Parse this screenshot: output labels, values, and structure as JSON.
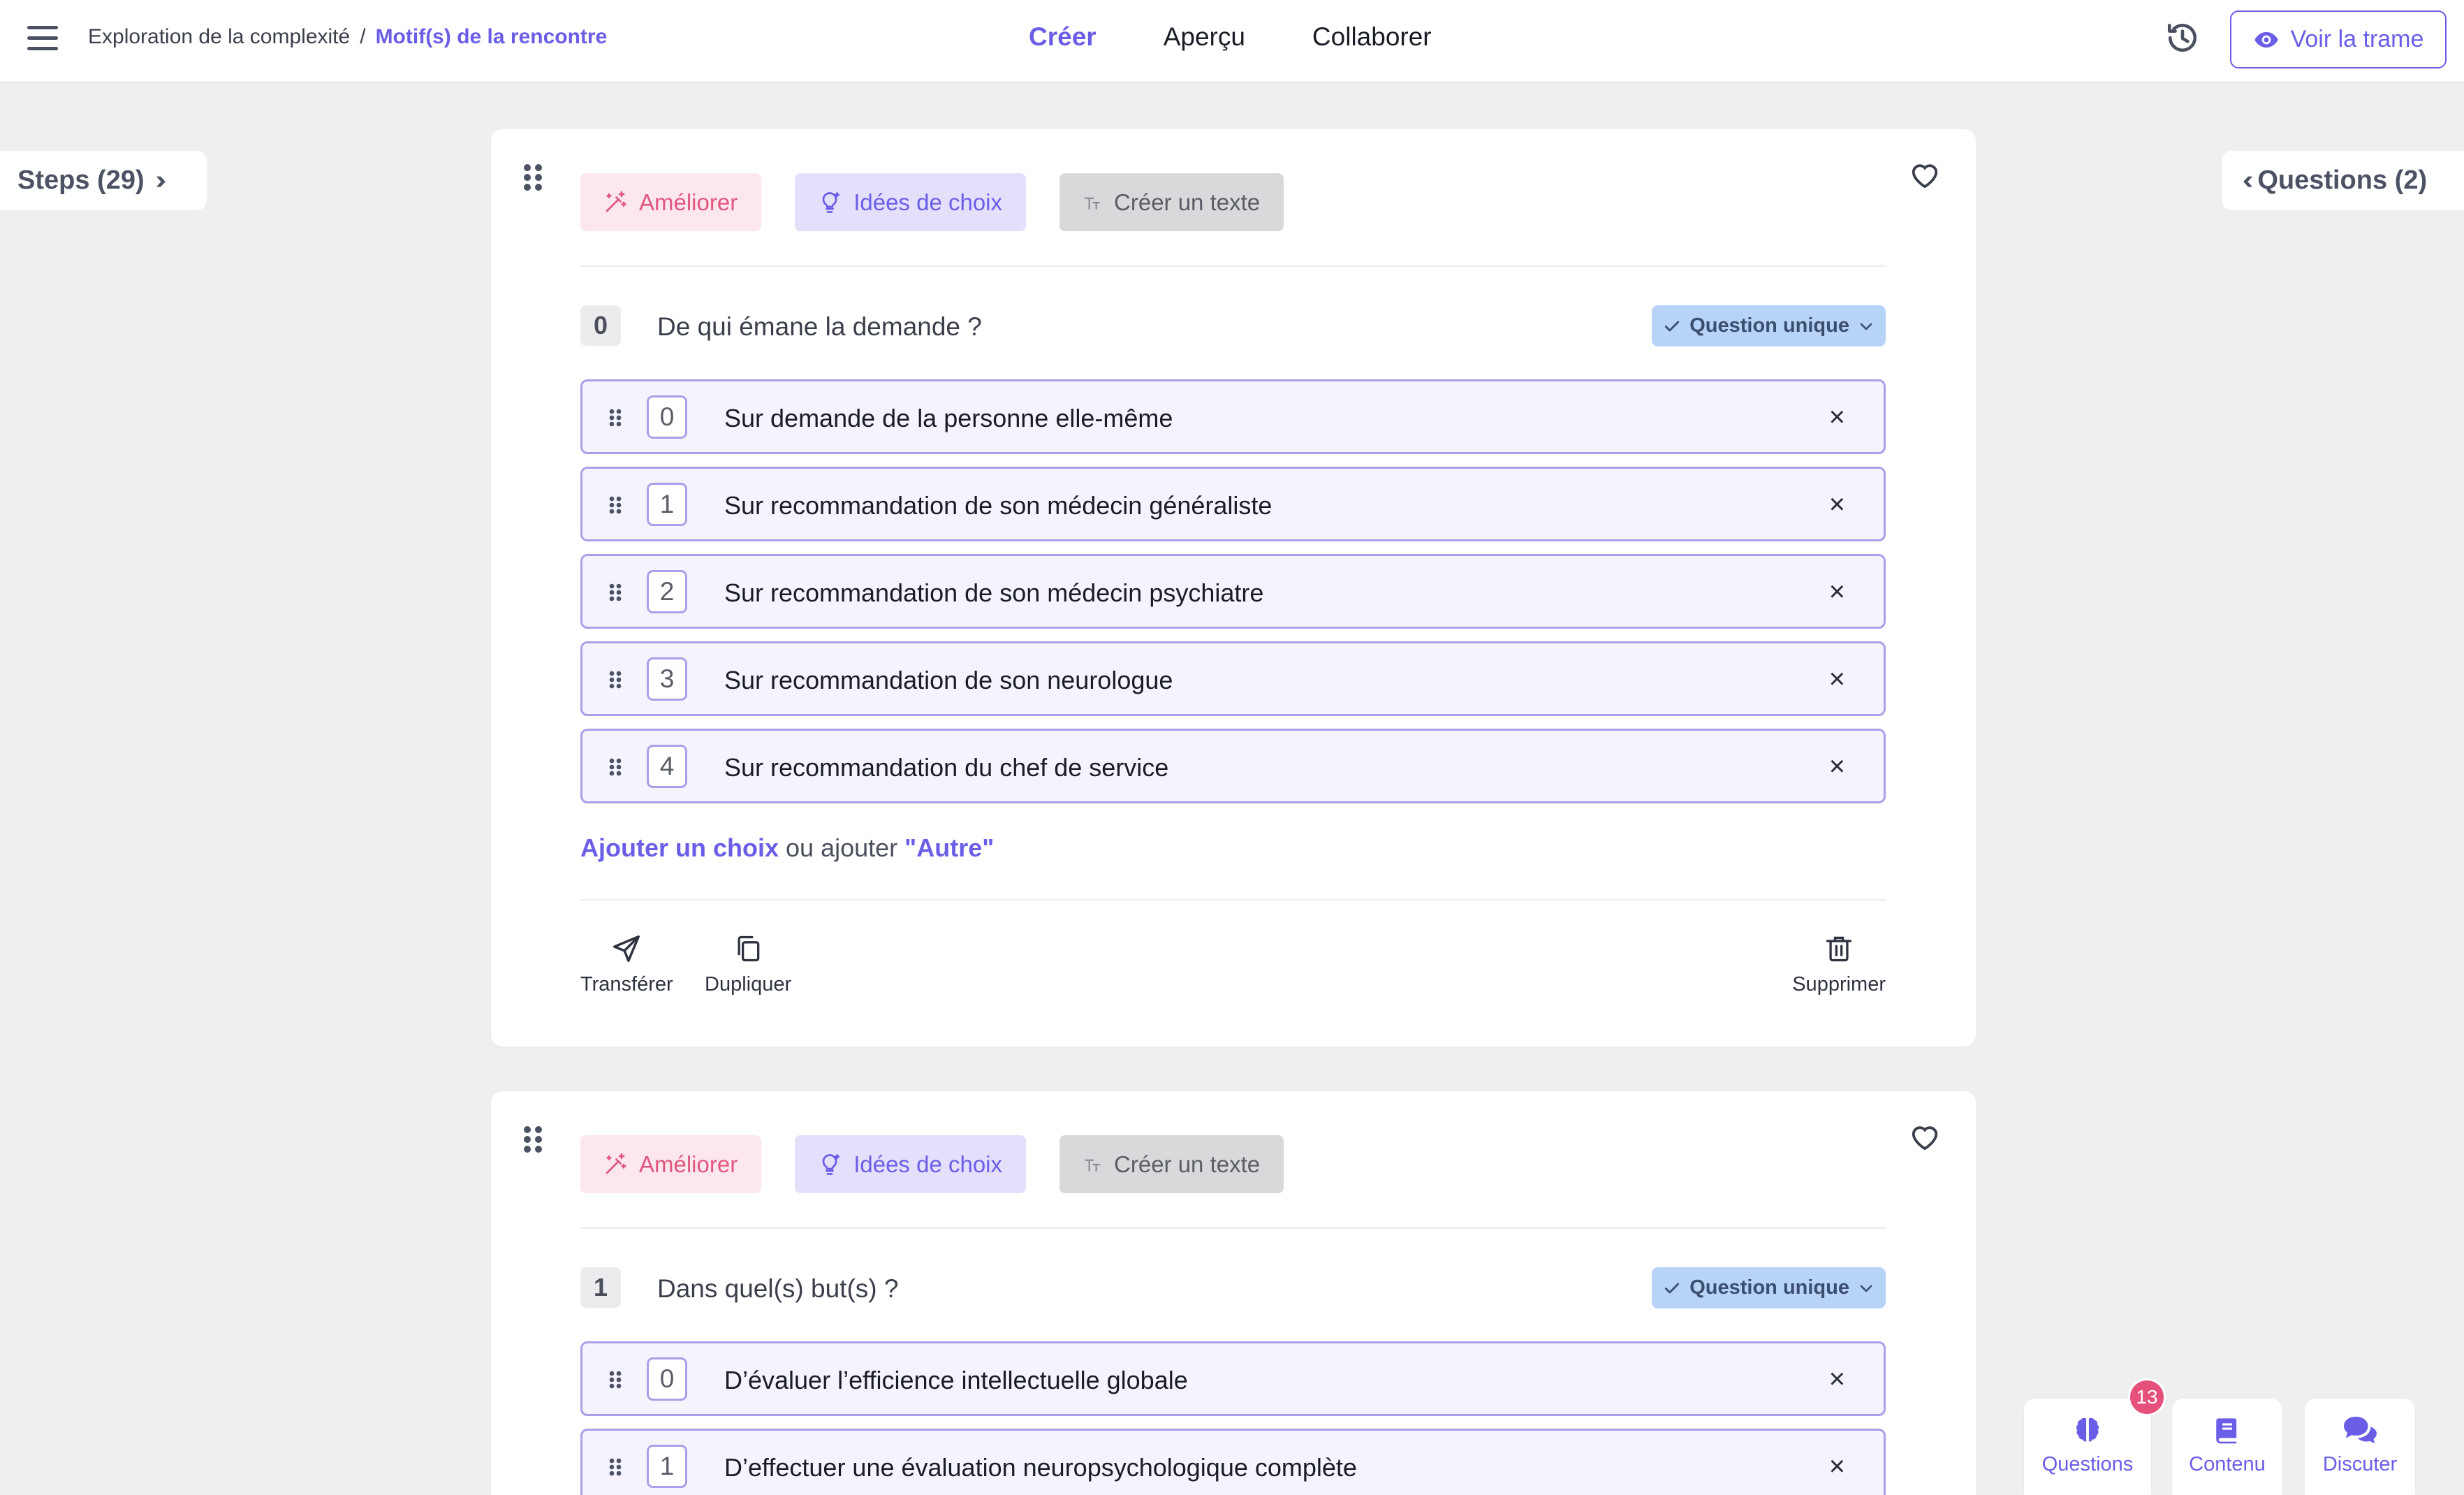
{
  "breadcrumb": {
    "parent": "Exploration de la complexité",
    "separator": "/",
    "current": "Motif(s) de la rencontre"
  },
  "tabs": [
    {
      "label": "Créer",
      "active": true
    },
    {
      "label": "Aperçu",
      "active": false
    },
    {
      "label": "Collaborer",
      "active": false
    }
  ],
  "header": {
    "voir_label": "Voir la trame"
  },
  "side": {
    "steps_label": "Steps (29)",
    "questions_label": "Questions (2)"
  },
  "ai_buttons": {
    "improve": "Améliorer",
    "ideas": "Idées de choix",
    "text": "Créer un texte"
  },
  "questions": [
    {
      "number": "0",
      "title": "De qui émane la demande ?",
      "type": "Question unique",
      "choices": [
        {
          "number": "0",
          "label": "Sur demande de la personne elle-même"
        },
        {
          "number": "1",
          "label": "Sur recommandation de son médecin généraliste"
        },
        {
          "number": "2",
          "label": "Sur recommandation de son médecin psychiatre"
        },
        {
          "number": "3",
          "label": "Sur recommandation de son neurologue"
        },
        {
          "number": "4",
          "label": "Sur recommandation du chef de service"
        }
      ],
      "add_choice": "Ajouter un choix",
      "add_or": "ou ajouter",
      "add_other": "\"Autre\"",
      "actions": {
        "transfer": "Transférer",
        "duplicate": "Dupliquer",
        "delete": "Supprimer"
      }
    },
    {
      "number": "1",
      "title": "Dans quel(s) but(s) ?",
      "type": "Question unique",
      "choices": [
        {
          "number": "0",
          "label": "D’évaluer l’efficience intellectuelle globale"
        },
        {
          "number": "1",
          "label": "D’effectuer une évaluation neuropsychologique complète"
        }
      ]
    }
  ],
  "bottom": {
    "questions_label": "Questions",
    "questions_badge": "13",
    "content_label": "Contenu",
    "discuss_label": "Discuter"
  },
  "colors": {
    "accent": "#6a5ee6",
    "pink": "#e0577f",
    "badge": "#e5517b",
    "type_chip": "#b7d3f7"
  }
}
